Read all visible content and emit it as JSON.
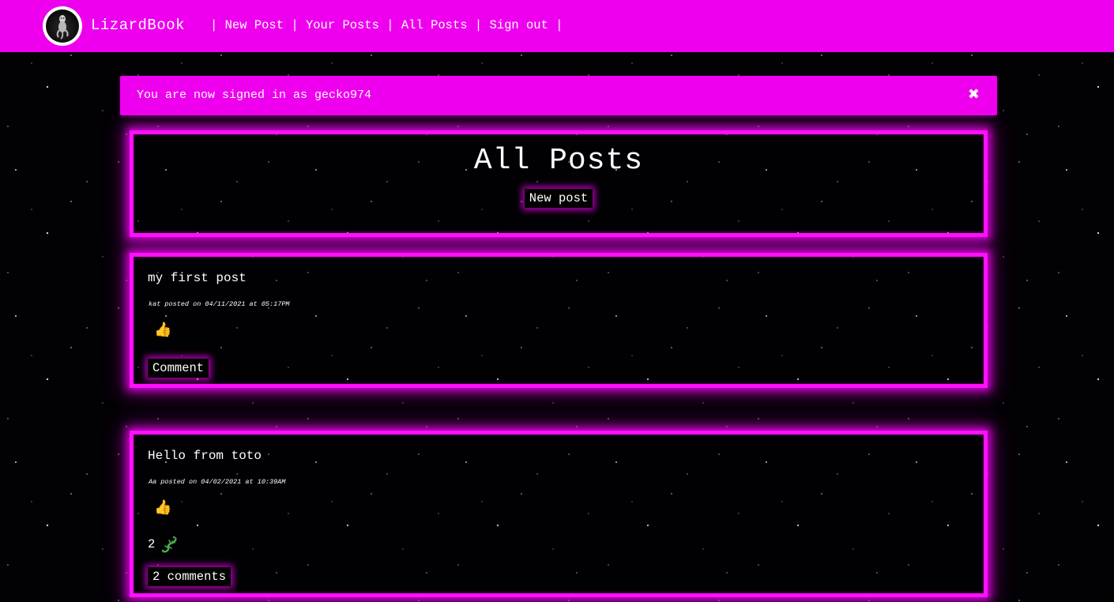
{
  "nav": {
    "brand": "LizardBook",
    "links": [
      "New Post",
      "Your Posts",
      "All Posts",
      "Sign out"
    ],
    "accent_color": "#ee00ee"
  },
  "flash": {
    "message": "You are now signed in as gecko974",
    "close_icon": "close-icon"
  },
  "page": {
    "title": "All Posts",
    "new_post_button": "New post"
  },
  "posts": [
    {
      "title": "my first post",
      "meta": "kat posted on 04/11/2021 at 05:17PM",
      "like_icon": "thumbs-up-icon",
      "button": "Comment"
    },
    {
      "title": "Hello from toto",
      "meta": "Aa posted on 04/02/2021 at 10:39AM",
      "like_icon": "thumbs-up-icon",
      "lizard_count": "2",
      "lizard_icon": "lizard-icon",
      "button": "2 comments"
    }
  ]
}
